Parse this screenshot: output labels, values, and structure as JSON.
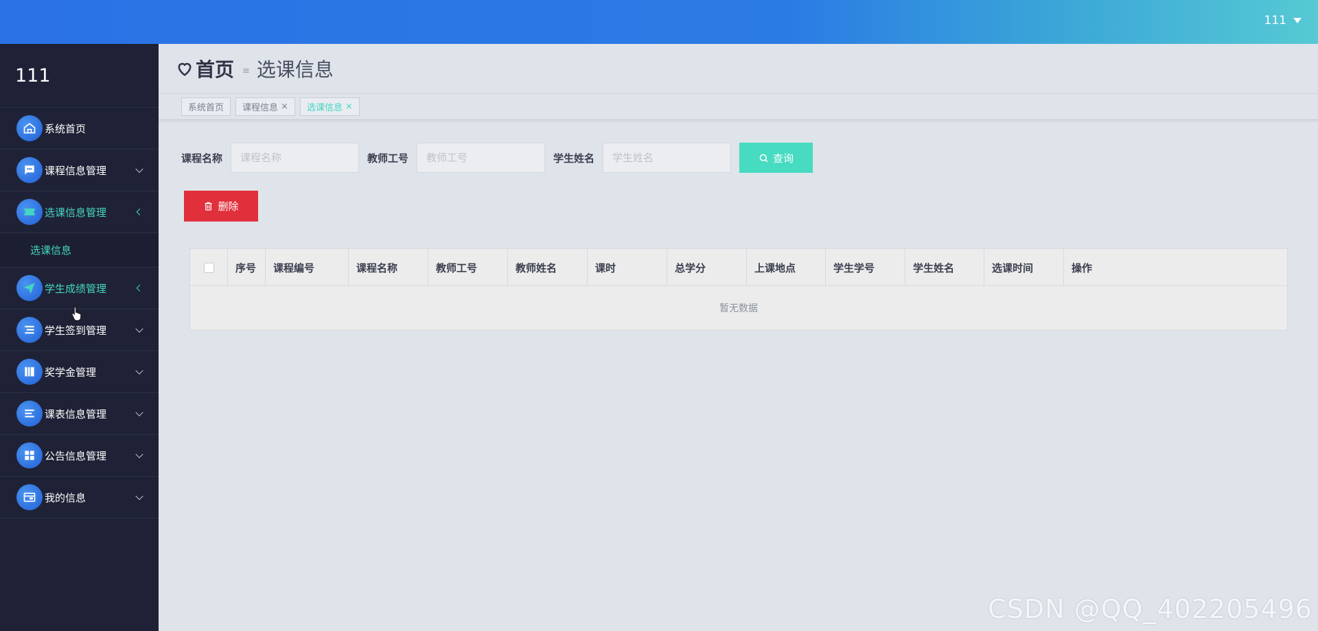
{
  "topbar": {
    "user": "111"
  },
  "sidebar": {
    "brand": "111",
    "items": [
      {
        "label": "系统首页",
        "icon": "home-icon"
      },
      {
        "label": "课程信息管理",
        "icon": "chat-icon"
      },
      {
        "label": "选课信息管理",
        "icon": "ticket-icon"
      },
      {
        "label": "学生成绩管理",
        "icon": "send-icon"
      },
      {
        "label": "学生签到管理",
        "icon": "list-icon"
      },
      {
        "label": "奖学金管理",
        "icon": "book-icon"
      },
      {
        "label": "课表信息管理",
        "icon": "menu-icon"
      },
      {
        "label": "公告信息管理",
        "icon": "grid-icon"
      },
      {
        "label": "我的信息",
        "icon": "card-icon"
      }
    ],
    "submenu": {
      "label": "选课信息"
    }
  },
  "breadcrumb": {
    "home": "首页",
    "separator": "≡",
    "current": "选课信息"
  },
  "tabs": [
    {
      "label": "系统首页"
    },
    {
      "label": "课程信息",
      "close": "×"
    },
    {
      "label": "选课信息",
      "close": "×"
    }
  ],
  "search": {
    "course_name_label": "课程名称",
    "course_name_placeholder": "课程名称",
    "teacher_id_label": "教师工号",
    "teacher_id_placeholder": "教师工号",
    "student_name_label": "学生姓名",
    "student_name_placeholder": "学生姓名",
    "query_button": "查询"
  },
  "actions": {
    "delete_button": "删除"
  },
  "table": {
    "columns": [
      "序号",
      "课程编号",
      "课程名称",
      "教师工号",
      "教师姓名",
      "课时",
      "总学分",
      "上课地点",
      "学生学号",
      "学生姓名",
      "选课时间",
      "操作"
    ],
    "empty_text": "暂无数据"
  },
  "watermark": "CSDN @QQ_402205496",
  "colors": {
    "accent": "#44d6c1",
    "danger": "#e0303b",
    "sidebar": "#1f2236",
    "topbar": "#2a72e6"
  }
}
